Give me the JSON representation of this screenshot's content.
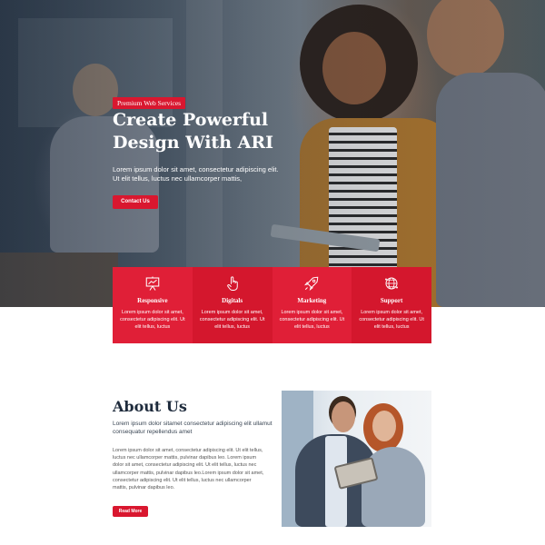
{
  "hero": {
    "badge": "Premium Web Services",
    "title": "Create Powerful Design With ARI",
    "text": "Lorem ipsum dolor sit amet, consectetur adipiscing elit. Ut elit tellus, luctus nec ullamcorper mattis,",
    "button": "Contact Us"
  },
  "services": [
    {
      "title": "Responsive",
      "icon": "presentation-board-icon",
      "text": "Lorem ipsum dolor sit amet, consectetur adipiscing elit. Ut elit tellus, luctus"
    },
    {
      "title": "Digitals",
      "icon": "hand-pointer-icon",
      "text": "Lorem ipsum dolor sit amet, consectetur adipiscing elit. Ut elit tellus, luctus"
    },
    {
      "title": "Marketing",
      "icon": "rocket-icon",
      "text": "Lorem ipsum dolor sit amet, consectetur adipiscing elit. Ut elit tellus, luctus"
    },
    {
      "title": "Support",
      "icon": "globe-network-icon",
      "text": "Lorem ipsum dolor sit amet, consectetur adipiscing elit. Ut elit tellus, luctus"
    }
  ],
  "about": {
    "title": "About Us",
    "subtitle": "Lorem ipsum dolor sitamet consectetur adipiscing elit ullamut consequatur repellendus amet",
    "body": "Lorem ipsum dolor sit amet, consectetur adipiscing elit. Ut elit tellus, luctus nec ullamcorper mattis, pulvinar dapibus leo. Lorem ipsum dolor sit amet, consectetur adipiscing elit. Ut elit tellus, luctus nec ullamcorper mattis, pulvinar dapibus leo.Lorem ipsum dolor sit amet, consectetur adipiscing elit. Ut elit tellus, luctus nec ullamcorper mattis, pulvinar dapibus leo.",
    "button": "Read More"
  },
  "colors": {
    "accent": "#d9172f",
    "heading": "#1e2b3c"
  }
}
